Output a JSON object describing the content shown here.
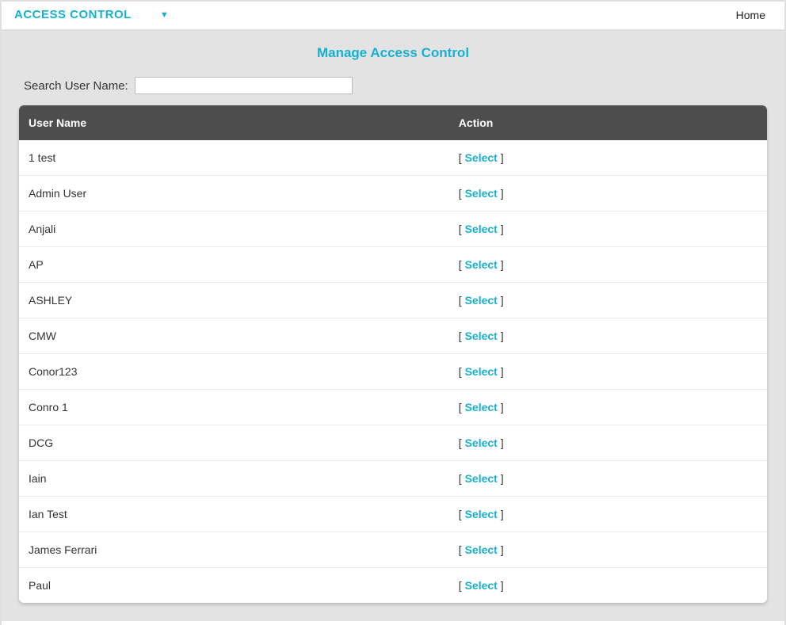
{
  "topbar": {
    "title": "ACCESS CONTROL",
    "home": "Home"
  },
  "page": {
    "title": "Manage Access Control"
  },
  "search": {
    "label": "Search User Name:",
    "value": ""
  },
  "table": {
    "headers": {
      "user": "User Name",
      "action": "Action"
    },
    "select_label": "Select",
    "open_bracket": "[ ",
    "close_bracket": " ]",
    "rows": [
      {
        "user": "1 test"
      },
      {
        "user": "Admin User"
      },
      {
        "user": "Anjali"
      },
      {
        "user": "AP"
      },
      {
        "user": "ASHLEY"
      },
      {
        "user": "CMW"
      },
      {
        "user": "Conor123"
      },
      {
        "user": "Conro 1"
      },
      {
        "user": "DCG"
      },
      {
        "user": "Iain"
      },
      {
        "user": "Ian Test"
      },
      {
        "user": "James Ferrari"
      },
      {
        "user": "Paul"
      }
    ]
  }
}
